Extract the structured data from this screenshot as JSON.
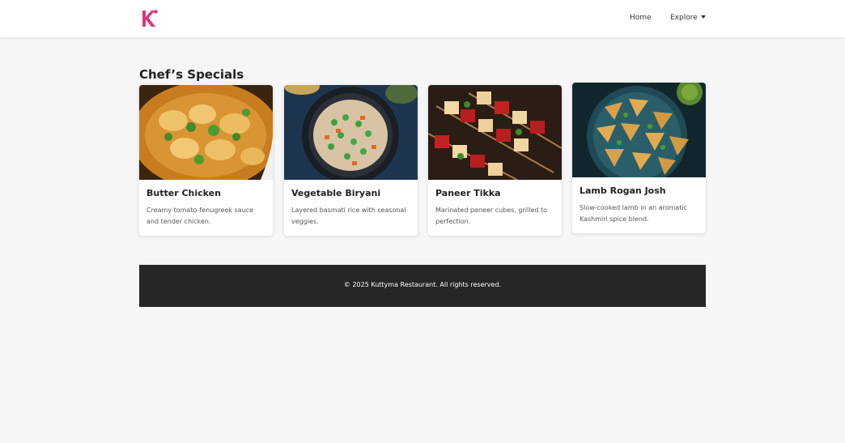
{
  "navbar": {
    "logo": "K",
    "links": [
      {
        "label": "Home"
      },
      {
        "label": "Explore"
      }
    ]
  },
  "colors": {
    "brand": "#e0317b",
    "footer_bg": "#262626",
    "page_bg": "#f6f6f6"
  },
  "main": {
    "section_title": "Chef’s Specials",
    "cards": [
      {
        "title": "Butter Chicken",
        "description": "Creamy tomato-fenugreek sauce and tender chicken."
      },
      {
        "title": "Vegetable Biryani",
        "description": "Layered basmati rice with seasonal veggies."
      },
      {
        "title": "Paneer Tikka",
        "description": "Marinated paneer cubes, grilled to perfection."
      },
      {
        "title": "Lamb Rogan Josh",
        "description": "Slow-cooked lamb in an aromatic Kashmiri spice blend."
      }
    ]
  },
  "footer": {
    "text": "© 2025 Kuttyma Restaurant. All rights reserved."
  }
}
